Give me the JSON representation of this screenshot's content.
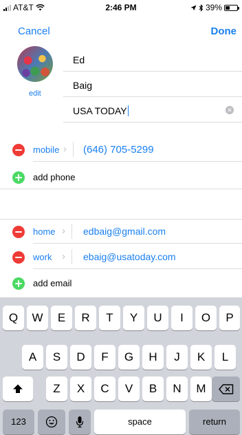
{
  "status_bar": {
    "carrier": "AT&T",
    "time": "2:46 PM",
    "battery_percent": "39%",
    "battery_level": 0.39,
    "wifi_icon": "wifi-icon",
    "location_icon": "location-arrow-icon",
    "bluetooth_icon": "bluetooth-icon"
  },
  "nav": {
    "cancel_label": "Cancel",
    "done_label": "Done"
  },
  "photo": {
    "edit_label": "edit"
  },
  "name_fields": {
    "first": "Ed",
    "last": "Baig",
    "company": "USA TODAY"
  },
  "phones": {
    "items": [
      {
        "type": "mobile",
        "value": "(646) 705-5299"
      }
    ],
    "add_label": "add phone"
  },
  "emails": {
    "items": [
      {
        "type": "home",
        "value": "edbaig@gmail.com"
      },
      {
        "type": "work",
        "value": "ebaig@usatoday.com"
      }
    ],
    "add_label": "add email"
  },
  "keyboard": {
    "row1": [
      "Q",
      "W",
      "E",
      "R",
      "T",
      "Y",
      "U",
      "I",
      "O",
      "P"
    ],
    "row2": [
      "A",
      "S",
      "D",
      "F",
      "G",
      "H",
      "J",
      "K",
      "L"
    ],
    "row3": [
      "Z",
      "X",
      "C",
      "V",
      "B",
      "N",
      "M"
    ],
    "numbers_label": "123",
    "space_label": "space",
    "return_label": "return",
    "shift_icon": "shift-icon",
    "delete_icon": "delete-icon",
    "emoji_icon": "emoji-icon",
    "mic_icon": "microphone-icon"
  },
  "colors": {
    "accent": "#1a7ff0",
    "delete_red": "#ef3b36",
    "add_green": "#4cd964"
  }
}
